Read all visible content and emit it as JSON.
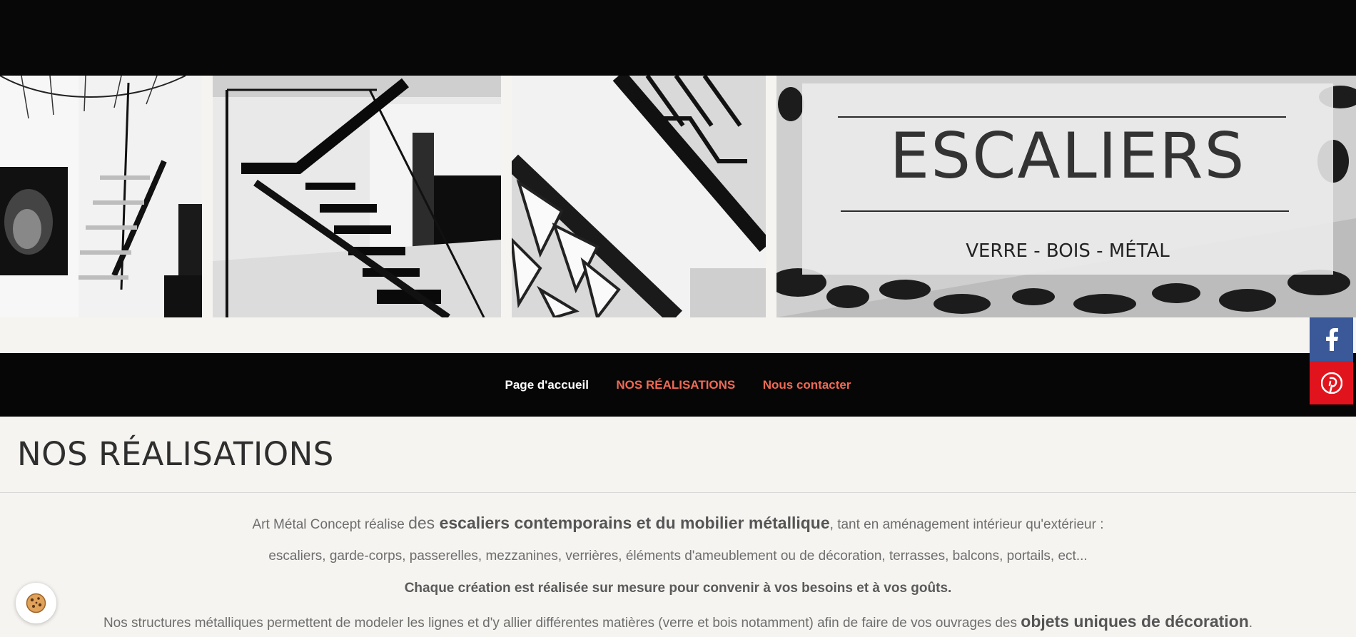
{
  "banner": {
    "title": "ESCALIERS",
    "subtitle": "VERRE - BOIS - MÉTAL"
  },
  "nav": {
    "items": [
      {
        "label": "Page d'accueil",
        "color": "#ffffff"
      },
      {
        "label": "NOS RÉALISATIONS",
        "color": "#f06a55"
      },
      {
        "label": "Nous contacter",
        "color": "#f06a55"
      }
    ]
  },
  "social": {
    "facebook_color": "#3b5998",
    "pinterest_color": "#e1141d",
    "icons": [
      "facebook-icon",
      "pinterest-icon"
    ]
  },
  "page": {
    "title": "NOS RÉALISATIONS"
  },
  "intro": {
    "p1_a": "Art Métal Concept réalise ",
    "p1_b": "des ",
    "p1_c": "escaliers contemporains et du mobilier métallique",
    "p1_d": ", tant en aménagement intérieur qu'extérieur :",
    "p2": "escaliers, garde-corps, passerelles, mezzanines, verrières, éléments d'ameublement ou de décoration, terrasses, balcons, portails, ect...",
    "p3": "Chaque création est réalisée sur mesure pour convenir à vos besoins et à vos goûts.",
    "p4_a": "Nos structures métalliques permettent de modeler les lignes et d'y allier différentes matières (verre et bois notamment) afin de faire de vos ouvrages des ",
    "p4_b": "objets uniques de décoration",
    "p4_c": "."
  },
  "cookie": {
    "icon": "cookie-icon"
  }
}
